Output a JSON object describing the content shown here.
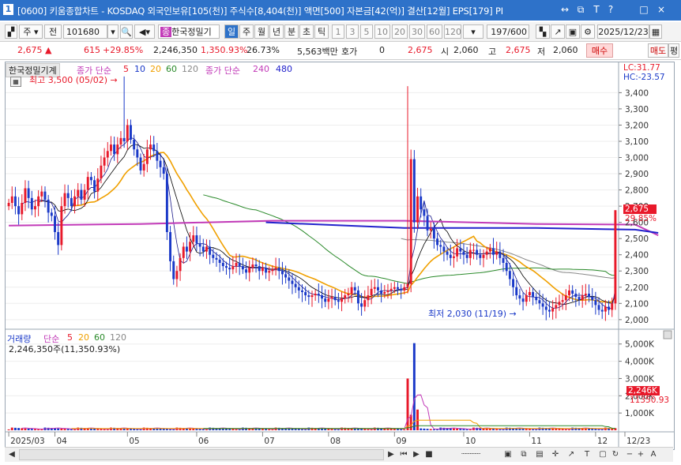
{
  "window": {
    "icon": "1",
    "title": "[0600] 키움종합차트 - KOSDAQ 외국인보유[105(천)] 주식수[8,404(천)] 액면[500] 자본금[42(억)] 결산[12월] EPS[179] PI",
    "controls": [
      "↔",
      "⧉",
      "T",
      "?",
      "□",
      "×"
    ]
  },
  "toolbar": {
    "mode_ju": "주",
    "mode_jeon": "전",
    "code": "101680",
    "stock_name": "한국정밀기",
    "period_tabs": [
      "일",
      "주",
      "월",
      "년",
      "분",
      "초",
      "틱"
    ],
    "intervals": [
      "1",
      "3",
      "5",
      "10",
      "20",
      "30",
      "60",
      "120"
    ],
    "count": "197",
    "count_total": "/600",
    "date": "2025/12/23"
  },
  "info": {
    "price": "2,675",
    "change": "615",
    "change_pct": "+29.85%",
    "volume": "2,246,350",
    "vol_pct": "1,350.93%",
    "turnover": "26.73%",
    "amount": "5,563백만",
    "hoga_label": "호가",
    "hoga_val": "0",
    "hoga_price": "2,675",
    "open_label": "시",
    "open": "2,060",
    "high_label": "고",
    "high": "2,675",
    "low_label": "저",
    "low": "2,060",
    "buy": "매수",
    "sell": "매도",
    "eval": "평"
  },
  "price_panel": {
    "stock_label": "한국정밀기계",
    "ma_short_label": "종가 단순",
    "ma_short": [
      "5",
      "10",
      "20",
      "60",
      "120"
    ],
    "ma_long_label": "종가 단순",
    "ma_long": [
      "240",
      "480"
    ],
    "high_note": "최고 3,500 (05/02)",
    "low_note": "최저 2,030 (11/19)",
    "lc": "LC:31.77",
    "hc": "HC:-23.57",
    "last_price_tag": "2,675",
    "last_pct_tag": "29.85%"
  },
  "volume_panel": {
    "label": "거래량",
    "ma_label": "단순",
    "ma": [
      "5",
      "20",
      "60",
      "120"
    ],
    "value": "2,246,350주(11,350.93%)",
    "last_tag": "2,246K",
    "last_pct_tag": "11350.93"
  },
  "colors": {
    "up": "#e8192a",
    "down": "#1a39c8",
    "ma5": "#1a1a8a",
    "ma10": "#000000",
    "ma20": "#f0a000",
    "ma60": "#2a8a2a",
    "ma120": "#888888",
    "ma240": "#c23ab8",
    "ma480": "#2222cc"
  },
  "chart_data": [
    {
      "type": "candlestick",
      "title": "한국정밀기계",
      "x": [
        "2025/03",
        "04",
        "05",
        "06",
        "07",
        "08",
        "09",
        "10",
        "11",
        "12",
        "12/23"
      ],
      "y_ticks": [
        2000,
        2100,
        2200,
        2300,
        2400,
        2500,
        2600,
        2700,
        2800,
        2900,
        3000,
        3100,
        3200,
        3300,
        3400
      ],
      "ylim": [
        1970,
        3470
      ],
      "closes": [
        2720,
        2760,
        2700,
        2650,
        2720,
        2810,
        2750,
        2680,
        2700,
        2760,
        2790,
        2740,
        2660,
        2640,
        2540,
        2460,
        2700,
        2780,
        2750,
        2700,
        2760,
        2800,
        2740,
        2800,
        2880,
        2860,
        2790,
        2870,
        2950,
        3000,
        3040,
        3080,
        3020,
        3080,
        3120,
        3100,
        3200,
        3110,
        3050,
        3000,
        2920,
        2960,
        3050,
        3080,
        3040,
        2980,
        2940,
        2900,
        2540,
        2360,
        2250,
        2300,
        2380,
        2450,
        2420,
        2480,
        2520,
        2470,
        2450,
        2420,
        2450,
        2400,
        2380,
        2370,
        2350,
        2330,
        2320,
        2310,
        2330,
        2350,
        2330,
        2310,
        2290,
        2320,
        2340,
        2330,
        2300,
        2320,
        2290,
        2300,
        2310,
        2320,
        2300,
        2280,
        2260,
        2240,
        2220,
        2200,
        2180,
        2170,
        2150,
        2140,
        2150,
        2160,
        2150,
        2130,
        2110,
        2130,
        2140,
        2120,
        2110,
        2130,
        2150,
        2160,
        2200,
        2180,
        2100,
        2080,
        2120,
        2150,
        2190,
        2200,
        2180,
        2160,
        2170,
        2180,
        2190,
        2200,
        2190,
        2180,
        2200,
        2220,
        2990,
        2600,
        2760,
        2680,
        2640,
        2550,
        2560,
        2500,
        2460,
        2450,
        2420,
        2400,
        2380,
        2390,
        2440,
        2420,
        2400,
        2380,
        2430,
        2430,
        2400,
        2380,
        2400,
        2420,
        2440,
        2400,
        2420,
        2380,
        2350,
        2300,
        2250,
        2200,
        2150,
        2130,
        2110,
        2150,
        2170,
        2140,
        2120,
        2100,
        2080,
        2060,
        2050,
        2070,
        2090,
        2110,
        2120,
        2150,
        2180,
        2160,
        2140,
        2120,
        2150,
        2160,
        2140,
        2120,
        2090,
        2060,
        2050,
        2080,
        2060,
        2100,
        2675
      ],
      "ma240": [
        [
          0,
          2580
        ],
        [
          40,
          2590
        ],
        [
          80,
          2610
        ],
        [
          120,
          2610
        ],
        [
          160,
          2590
        ],
        [
          190,
          2586
        ],
        [
          197,
          2520
        ]
      ],
      "ma480": [
        [
          78,
          2600
        ],
        [
          120,
          2565
        ],
        [
          160,
          2565
        ],
        [
          190,
          2555
        ],
        [
          197,
          2535
        ]
      ],
      "annotations": [
        "최고 3,500 (05/02)",
        "최저 2,030 (11/19)"
      ]
    },
    {
      "type": "bar",
      "title": "거래량",
      "y_ticks": [
        1000000,
        2000000,
        3000000,
        4000000,
        5000000
      ],
      "y_tick_labels": [
        "1,000K",
        "2,000K",
        "3,000K",
        "4,000K",
        "5,000K"
      ],
      "ylim": [
        0,
        5400000
      ],
      "spikes": [
        [
          121,
          3000000
        ],
        [
          123,
          5050000
        ],
        [
          122,
          900000
        ],
        [
          124,
          1200000
        ],
        [
          196,
          2246350
        ]
      ],
      "base_volume": 120000
    }
  ]
}
